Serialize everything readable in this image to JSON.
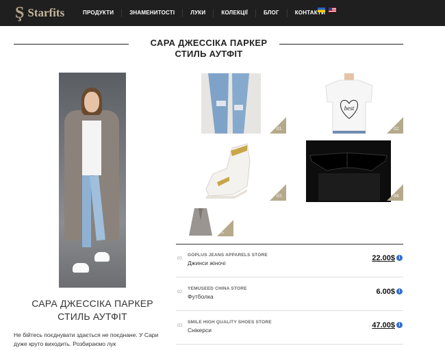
{
  "header": {
    "logo_mark": "Ş",
    "logo_text": "Starfits",
    "nav": [
      "ПРОДУКТИ",
      "ЗНАМЕНИТОСТІ",
      "ЛУКИ",
      "КОЛЕКЦІЇ",
      "БЛОГ",
      "КОНТАКТИ"
    ],
    "languages": [
      "ua-flag-icon",
      "us-flag-icon"
    ]
  },
  "title": {
    "line1": "САРА ДЖЕССІКА ПАРКЕР",
    "line2": "СТИЛЬ АУТФІТ"
  },
  "products": [
    {
      "num": "01.",
      "store": "GOPLUS JEANS APPARELS STORE",
      "item": "Джинси жіночі",
      "price": "22.00$"
    },
    {
      "num": "02.",
      "store": "YEMUSEED CHINA STORE",
      "item": "Футболка",
      "price": "6.00$"
    },
    {
      "num": "03.",
      "store": "SMILE HIGH QUALITY SHOES STORE",
      "item": "Снікерси",
      "price": "47.00$"
    }
  ],
  "thumb_badges": [
    "01.",
    "02.",
    "03.",
    "04.",
    "05."
  ],
  "tshirt_print": "best",
  "caption": {
    "title": "САРА ДЖЕССІКА ПАРКЕР СТИЛЬ АУТФІТ",
    "text": "Не бійтесь поєднувати здається не поєднане. У Сари дуже круто виходить. Розбираємо лук"
  },
  "colors": {
    "header_bg": "#1f1f1f",
    "logo_gold": "#b3a48a",
    "badge_gold": "#b5a98c",
    "info_blue": "#2f6fd0"
  }
}
